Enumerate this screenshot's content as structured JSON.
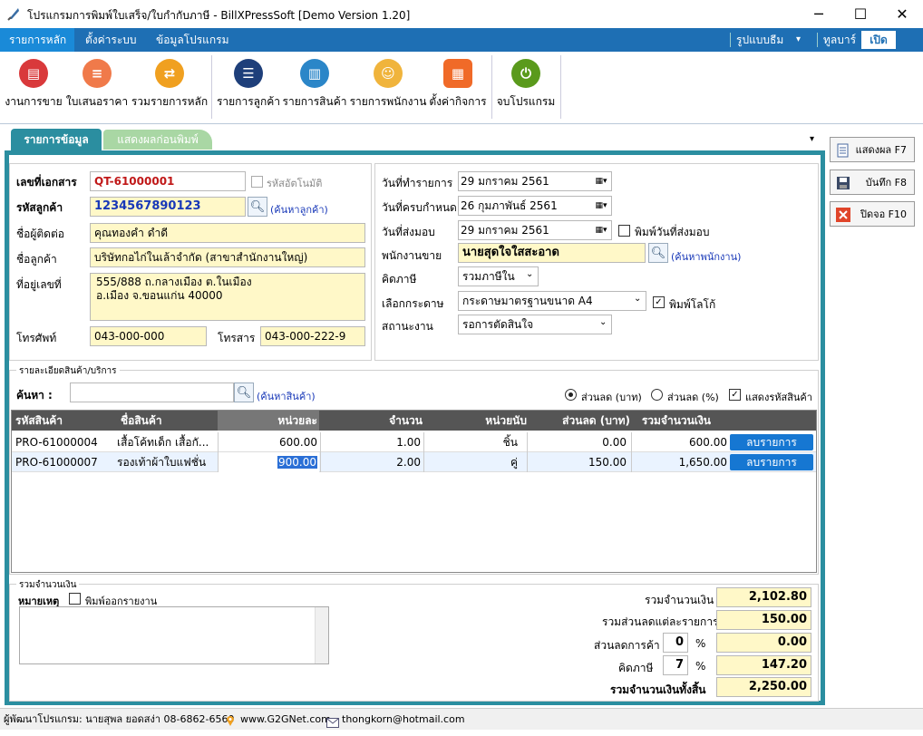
{
  "window": {
    "title": "โปรแกรมการพิมพ์ใบเสร็จ/ใบกำกับภาษี - BillXPressSoft [Demo Version 1.20]",
    "minimize": "─",
    "maximize": "☐",
    "close": "✕"
  },
  "menu": {
    "items": [
      "รายการหลัก",
      "ตั้งค่าระบบ",
      "ข้อมูลโปรแกรม"
    ],
    "style_label": "รูปแบบธีม",
    "dropdown_caret": "▾",
    "toolbar_label": "ทูลบาร์",
    "toolbar_toggle": "เปิด"
  },
  "ribbon": [
    {
      "label": "งานการขาย",
      "icon": "sales-icon",
      "color": "#d9393b"
    },
    {
      "label": "ใบเสนอราคา",
      "icon": "quotation-icon",
      "color": "#f07a4a"
    },
    {
      "label": "รวมรายการหลัก",
      "icon": "transfer-icon",
      "color": "#f0a020"
    },
    {
      "label": "รายการลูกค้า",
      "icon": "customer-icon",
      "color": "#1e3f7a"
    },
    {
      "label": "รายการสินค้า",
      "icon": "product-icon",
      "color": "#2b86c8"
    },
    {
      "label": "รายการพนักงาน",
      "icon": "staff-icon",
      "color": "#f0b43c"
    },
    {
      "label": "ตั้งค่ากิจการ",
      "icon": "settings-icon",
      "color": "#f06a28"
    },
    {
      "label": "จบโปรแกรม",
      "icon": "power-icon",
      "color": "#5a9a1c"
    }
  ],
  "tabs": {
    "active": "รายการข้อมูล",
    "second": "แสดงผลก่อนพิมพ์",
    "more": "▾"
  },
  "side_buttons": {
    "preview": "แสดงผล F7",
    "save": "บันทึก F8",
    "close": "ปิดจอ F10"
  },
  "left_form": {
    "doc_no_label": "เลขที่เอกสาร",
    "doc_no": "QT-61000001",
    "auto_label": "รหัสอัตโนมัติ",
    "cust_code_label": "รหัสลูกค้า",
    "cust_code": "1234567890123",
    "find_customer": "(ค้นหาลูกค้า)",
    "contact_label": "ชื่อผู้ติดต่อ",
    "contact": "คุณทองคำ ดำดี",
    "cust_name_label": "ชื่อลูกค้า",
    "cust_name": "บริษัทกอไก่ในเล้าจำกัด (สาขาสำนักงานใหญ่)",
    "address_label": "ที่อยู่เลขที่",
    "address_line1": "555/888 ถ.กลางเมือง ต.ในเมือง",
    "address_line2": "อ.เมือง จ.ขอนแก่น 40000",
    "phone_label": "โทรศัพท์",
    "phone": "043-000-000",
    "fax_label": "โทรสาร",
    "fax": "043-000-222-9"
  },
  "right_form": {
    "date_label": "วันที่ทำรายการ",
    "date": "29   มกราคม    2561",
    "due_label": "วันที่ครบกำหนด",
    "due": "26  กุมภาพันธ์    2561",
    "delivery_label": "วันที่ส่งมอบ",
    "delivery": "29   มกราคม    2561",
    "print_delivery": "พิมพ์วันที่ส่งมอบ",
    "salesman_label": "พนักงานขาย",
    "salesman": "นายสุดใจใสสะอาด",
    "find_staff": "(ค้นหาพนักงาน)",
    "tax_label": "คิดภาษี",
    "tax": "รวมภาษีใน",
    "paper_label": "เลือกกระดาษ",
    "paper": "กระดาษมาตรฐานขนาด A4",
    "print_logo": "พิมพ์โลโก้",
    "status_label": "สถานะงาน",
    "status": "รอการตัดสินใจ"
  },
  "items_section": {
    "title": "รายละเอียดสินค้า/บริการ",
    "search_label": "ค้นหา :",
    "find_product": "(ค้นหาสินค้า)",
    "opt_baht": "ส่วนลด (บาท)",
    "opt_pct": "ส่วนลด (%)",
    "show_code": "แสดงรหัสสินค้า",
    "headers": [
      "รหัสสินค้า",
      "ชื่อสินค้า",
      "หน่วยละ",
      "จำนวน",
      "หน่วยนับ",
      "ส่วนลด (บาท)",
      "รวมจำนวนเงิน"
    ],
    "rows": [
      {
        "code": "PRO-61000004",
        "name": "เสื้อโค้ทเด็ก เสื้อกั...",
        "price": "600.00",
        "qty": "1.00",
        "unit": "ชิ้น",
        "disc": "0.00",
        "total": "600.00",
        "action": "ลบรายการ"
      },
      {
        "code": "PRO-61000007",
        "name": "รองเท้าผ้าใบแฟชั่น",
        "price": "900.00",
        "qty": "2.00",
        "unit": "คู่",
        "disc": "150.00",
        "total": "1,650.00",
        "action": "ลบรายการ"
      }
    ]
  },
  "summary": {
    "title": "รวมจำนวนเงิน",
    "note_label": "หมายเหตุ",
    "print_note": "พิมพ์ออกรายงาน",
    "subtotal_label": "รวมจำนวนเงิน",
    "subtotal": "2,102.80",
    "line_disc_label": "รวมส่วนลดแต่ละรายการ",
    "line_disc": "150.00",
    "trade_disc_label": "ส่วนลดการค้า",
    "trade_disc_pct": "0",
    "trade_disc": "0.00",
    "vat_label": "คิดภาษี",
    "vat_pct": "7",
    "vat": "147.20",
    "pct": "%",
    "grand_label": "รวมจำนวนเงินทั้งสิ้น",
    "grand": "2,250.00"
  },
  "statusbar": {
    "dev": "ผู้พัฒนาโปรแกรม: นายสุพล ยอดสง่า 08-6862-6560",
    "web": "www.G2GNet.com",
    "email": "thongkorn@hotmail.com"
  }
}
